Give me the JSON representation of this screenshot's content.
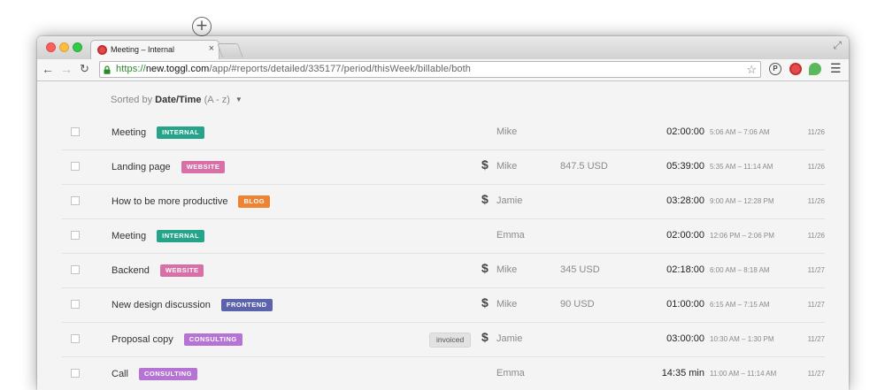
{
  "browser": {
    "tab_title": "Meeting – Internal",
    "tab_close": "×",
    "new_tab_symbol": "+",
    "url_scheme": "https://",
    "url_host": "new.toggl.com",
    "url_path": "/app/#reports/detailed/335177/period/thisWeek/billable/both"
  },
  "sort": {
    "prefix": "Sorted by ",
    "field": "Date/Time",
    "order": " (A - z)"
  },
  "tag_colors": {
    "INTERNAL": "#26a48a",
    "WEBSITE": "#d86fa6",
    "BLOG": "#ef8233",
    "FRONTEND": "#5a63ac",
    "CONSULTING": "#b574d4"
  },
  "rows": [
    {
      "description": "Meeting",
      "tag": "INTERNAL",
      "invoiced": "",
      "billable": false,
      "user": "Mike",
      "amount": "",
      "duration": "02:00:00",
      "range": "5:06 AM – 7:06 AM",
      "date": "11/26"
    },
    {
      "description": "Landing page",
      "tag": "WEBSITE",
      "invoiced": "",
      "billable": true,
      "user": "Mike",
      "amount": "847.5 USD",
      "duration": "05:39:00",
      "range": "5:35 AM – 11:14 AM",
      "date": "11/26"
    },
    {
      "description": "How to be more productive",
      "tag": "BLOG",
      "invoiced": "",
      "billable": true,
      "user": "Jamie",
      "amount": "",
      "duration": "03:28:00",
      "range": "9:00 AM – 12:28 PM",
      "date": "11/26"
    },
    {
      "description": "Meeting",
      "tag": "INTERNAL",
      "invoiced": "",
      "billable": false,
      "user": "Emma",
      "amount": "",
      "duration": "02:00:00",
      "range": "12:06 PM – 2:06 PM",
      "date": "11/26"
    },
    {
      "description": "Backend",
      "tag": "WEBSITE",
      "invoiced": "",
      "billable": true,
      "user": "Mike",
      "amount": "345 USD",
      "duration": "02:18:00",
      "range": "6:00 AM – 8:18 AM",
      "date": "11/27"
    },
    {
      "description": "New design discussion",
      "tag": "FRONTEND",
      "invoiced": "",
      "billable": true,
      "user": "Mike",
      "amount": "90 USD",
      "duration": "01:00:00",
      "range": "6:15 AM – 7:15 AM",
      "date": "11/27"
    },
    {
      "description": "Proposal copy",
      "tag": "CONSULTING",
      "invoiced": "invoiced",
      "billable": true,
      "user": "Jamie",
      "amount": "",
      "duration": "03:00:00",
      "range": "10:30 AM – 1:30 PM",
      "date": "11/27"
    },
    {
      "description": "Call",
      "tag": "CONSULTING",
      "invoiced": "",
      "billable": false,
      "user": "Emma",
      "amount": "",
      "duration": "14:35 min",
      "range": "11:00 AM – 11:14 AM",
      "date": "11/27"
    }
  ]
}
